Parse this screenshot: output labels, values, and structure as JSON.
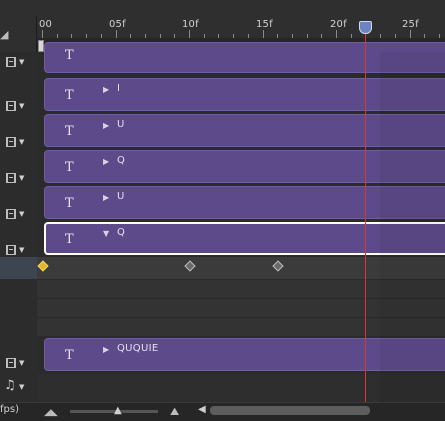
{
  "ruler": {
    "labels": [
      "00",
      "05f",
      "10f",
      "15f",
      "20f",
      "25f"
    ]
  },
  "tracks": [
    {
      "label": "I",
      "expanded": false
    },
    {
      "label": "U",
      "expanded": false
    },
    {
      "label": "Q",
      "expanded": false
    },
    {
      "label": "U",
      "expanded": false
    },
    {
      "label": "Q",
      "expanded": true
    },
    {
      "label": "QUQUIE",
      "expanded": false
    }
  ],
  "clip_type_icon": "T",
  "footer": {
    "fps_label": "fps)"
  },
  "colors": {
    "clip_fill": "#5c4a8a",
    "playhead": "#dd3333",
    "keyframe_first": "#e0b632",
    "work_range": "#4aa3a8"
  },
  "icons": [
    "film-strip-icon",
    "dropdown-caret-icon",
    "music-note-icon",
    "expand-triangle-icon",
    "keyframe-diamond-icon",
    "zoom-out-icon",
    "zoom-in-icon"
  ]
}
